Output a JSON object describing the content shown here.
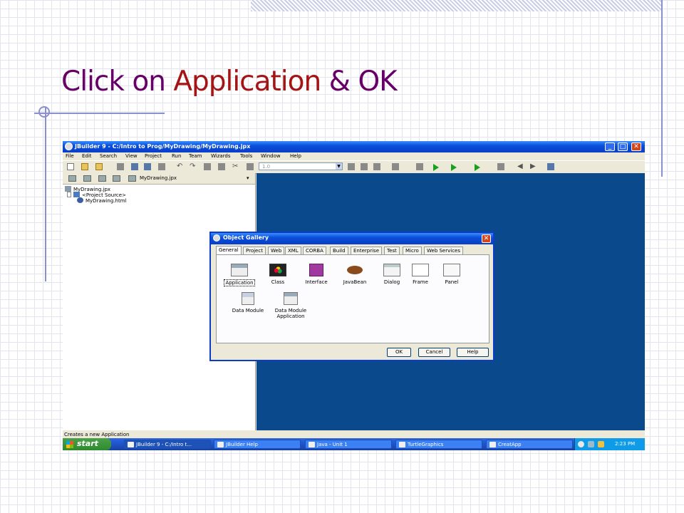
{
  "slide": {
    "title_prefix": "Click on ",
    "title_highlight": "Application",
    "title_suffix": " & OK"
  },
  "window": {
    "title": "JBuilder 9 - C:/Intro to Prog/MyDrawing/MyDrawing.jpx",
    "controls": {
      "minimize": "_",
      "maximize": "□",
      "close": "✕"
    }
  },
  "menu": [
    "File",
    "Edit",
    "Search",
    "View",
    "Project",
    "Run",
    "Team",
    "Wizards",
    "Tools",
    "Window",
    "Help"
  ],
  "toolbar": {
    "combo_value": "1.0"
  },
  "project": {
    "selector_label": "MyDrawing.jpx",
    "tree": [
      "MyDrawing.jpx",
      "<Project Source>",
      "MyDrawing.html"
    ]
  },
  "status_text": "Creates a new Application",
  "dialog": {
    "title": "Object Gallery",
    "tabs": [
      "General",
      "Project",
      "Web",
      "XML",
      "CORBA",
      "Build",
      "Enterprise",
      "Test",
      "Micro",
      "Web Services"
    ],
    "active_tab": "General",
    "items": [
      "Application",
      "Class",
      "Interface",
      "JavaBean",
      "Dialog",
      "Frame",
      "Panel",
      "Data Module",
      "Data Module Application"
    ],
    "selected_item": "Application",
    "buttons": {
      "ok": "OK",
      "cancel": "Cancel",
      "help": "Help"
    }
  },
  "taskbar": {
    "start_label": "start",
    "tasks": [
      "JBuilder 9 - C:/Intro t...",
      "JBuilder Help",
      "Java - Unit 1",
      "TurtleGraphics",
      "CreatApp"
    ],
    "clock": "2:23 PM"
  },
  "colors": {
    "title_purple": "#660066",
    "title_red": "#a41414",
    "desktop_blue": "#0a4a8c",
    "xp_title_blue": "#0a4fd8"
  }
}
